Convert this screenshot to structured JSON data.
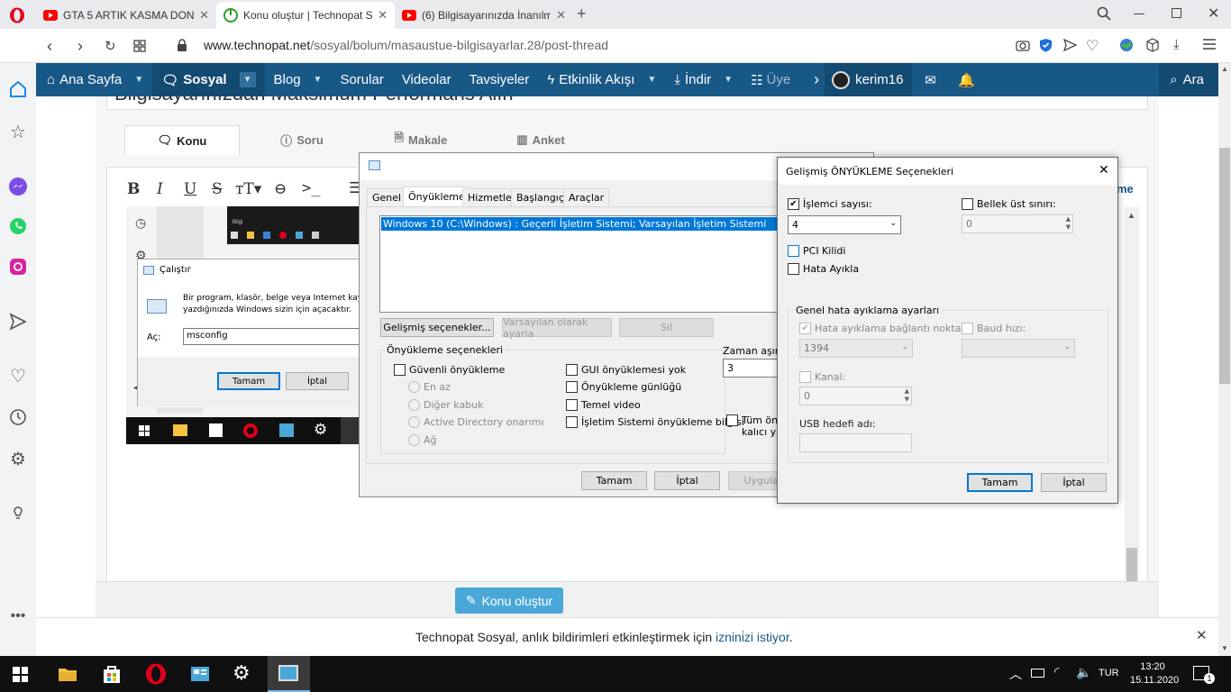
{
  "browser": {
    "tabs": [
      {
        "title": "GTA 5 ARTIK KASMA DONM",
        "icon": "youtube-icon"
      },
      {
        "title": "Konu oluştur | Technopat S",
        "icon": "technopat-icon"
      },
      {
        "title": "(6) Bilgisayarınızda İnanılm",
        "icon": "youtube-icon"
      }
    ],
    "url_host": "www.technopat.net",
    "url_path": "/sosyal/bolum/masaustue-bilgisayarlar.28/post-thread"
  },
  "site_nav": {
    "items": [
      "Ana Sayfa",
      "Sosyal",
      "Blog",
      "Sorular",
      "Videolar",
      "Tavsiyeler",
      "Etkinlik Akışı",
      "İndir",
      "Üye"
    ],
    "user": "kerim16",
    "search": "Ara"
  },
  "page": {
    "tabs": [
      "Konu",
      "Soru",
      "Makale",
      "Anket"
    ],
    "partial_title": "Bilgisayarınızdan Maksimum Performans Alın",
    "editor_right_label": "me",
    "submit_label": "Konu oluştur",
    "notification_text": "Technopat Sosyal, anlık bildirimleri etkinleştirmek için",
    "notification_link": "iznini̇zi istiyor",
    "notification_end": "."
  },
  "thumb": {
    "label": "Bilgi"
  },
  "run_dialog": {
    "title": "Çalıştır",
    "desc_line1": "Bir program, klasör, belge veya Internet kaynağı",
    "desc_line2": "yazdığınızda Windows sizin için açacaktır.",
    "open_label": "Aç:",
    "value": "msconfig",
    "ok": "Tamam",
    "cancel": "İptal"
  },
  "msconfig": {
    "tabs": [
      "Genel",
      "Önyükleme",
      "Hizmetler",
      "Başlangıç",
      "Araçlar"
    ],
    "boot_entry": "Windows 10 (C:\\Windows) : Geçerli İşletim Sistemi; Varsayılan İşletim Sistemi",
    "advanced_btn": "Gelişmiş seçenekler...",
    "default_btn": "Varsayılan olarak ayarla",
    "delete_btn": "Sil",
    "boot_options_label": "Önyükleme seçenekleri",
    "safe_boot": "Güvenli önyükleme",
    "radios": [
      "En az",
      "Diğer kabuk",
      "Active Directory onarımı",
      "Ağ"
    ],
    "right_checks": [
      "GUI önyüklemesi yok",
      "Önyükleme günlüğü",
      "Temel video",
      "İşletim Sistemi önyükleme bilgisi"
    ],
    "timeout_label": "Zaman aşımı:",
    "timeout_value": "3",
    "permanent_line1": "Tüm önyü",
    "permanent_line2": "kalıcı yap",
    "ok": "Tamam",
    "cancel": "İptal",
    "apply": "Uygula"
  },
  "advanced": {
    "title": "Gelişmiş ÖNYÜKLEME Seçenekleri",
    "cpu_label": "İşlemci sayısı:",
    "cpu_value": "4",
    "mem_label": "Bellek üst sınırı:",
    "mem_value": "0",
    "pci_lock": "PCI Kilidi",
    "debug": "Hata Ayıkla",
    "debug_group": "Genel hata ayıklama ayarları",
    "debug_port": "Hata ayıklama bağlantı noktası:",
    "debug_port_value": "1394",
    "baud": "Baud hızı:",
    "channel": "Kanal:",
    "channel_value": "0",
    "usb_target": "USB hedefi adı:",
    "ok": "Tamam",
    "cancel": "İptal"
  },
  "taskbar": {
    "lang": "TUR",
    "time": "13:20",
    "date": "15.11.2020",
    "notif_count": "1"
  },
  "colors": {
    "nav": "#185886",
    "accent": "#0078d7",
    "submit": "#4aa8d8"
  }
}
